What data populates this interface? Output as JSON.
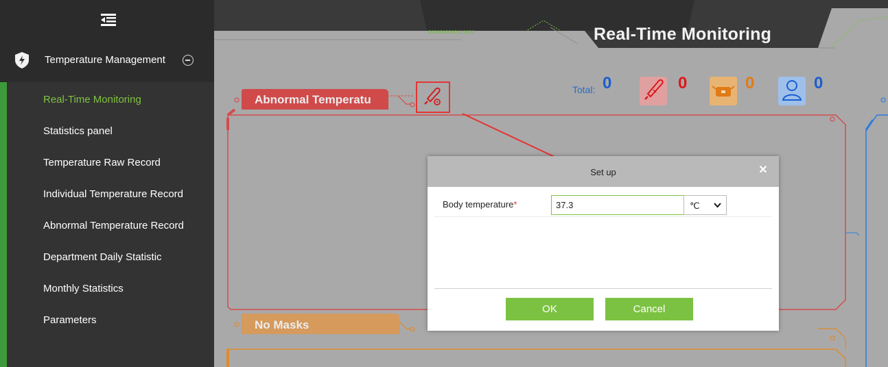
{
  "sidebar": {
    "module_label": "Temperature Management",
    "items": [
      {
        "label": "Real-Time Monitoring"
      },
      {
        "label": "Statistics panel"
      },
      {
        "label": "Temperature Raw Record"
      },
      {
        "label": "Individual Temperature Record"
      },
      {
        "label": "Abnormal Temperature Record"
      },
      {
        "label": "Department Daily Statistic"
      },
      {
        "label": "Monthly Statistics"
      },
      {
        "label": "Parameters"
      }
    ]
  },
  "header": {
    "title": "Real-Time Monitoring",
    "total_label": "Total:",
    "total_value": "0",
    "stats": [
      {
        "icon": "thermometer-icon",
        "value": "0",
        "color": "#e0161b"
      },
      {
        "icon": "mask-icon",
        "value": "0",
        "color": "#e07b16"
      },
      {
        "icon": "person-icon",
        "value": "0",
        "color": "#1b5fd0"
      }
    ],
    "code_strip": "0101010010111101"
  },
  "sections": {
    "abnormal_label": "Abnormal Temperatu",
    "no_masks_label": "No Masks"
  },
  "dialog": {
    "title": "Set up",
    "field_label": "Body temperature",
    "required_mark": "*",
    "value": "37.3",
    "unit": "℃",
    "ok_label": "OK",
    "cancel_label": "Cancel"
  },
  "colors": {
    "accent_green": "#7cc242",
    "active_menu": "#7fc241",
    "alert_red": "#e53333",
    "warn_orange": "#e08a2c",
    "info_blue": "#1b5fd0"
  }
}
